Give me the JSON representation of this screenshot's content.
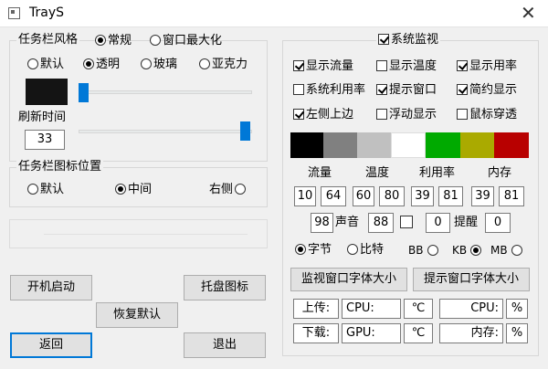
{
  "window": {
    "title": "TrayS",
    "close_glyph": "✕"
  },
  "taskbar_style": {
    "title": "任务栏风格",
    "mode_options": [
      "常规",
      "窗口最大化"
    ],
    "mode_selected": "常规",
    "effect_options": [
      "默认",
      "透明",
      "玻璃",
      "亚克力"
    ],
    "effect_selected": "透明",
    "color_swatch": "#141414",
    "alpha_level": 0.0,
    "refresh_label": "刷新时间",
    "refresh_value": "33",
    "refresh_level": 1.0
  },
  "icon_position": {
    "title": "任务栏图标位置",
    "options": [
      "默认",
      "中间",
      "右侧"
    ],
    "selected": "中间"
  },
  "left_buttons": {
    "autostart": "开机启动",
    "tray_icon": "托盘图标",
    "restore_default": "恢复默认",
    "back": "返回",
    "exit": "退出"
  },
  "monitor": {
    "title": "系统监视",
    "enabled": true,
    "checkboxes": [
      {
        "label": "显示流量",
        "checked": true
      },
      {
        "label": "显示温度",
        "checked": false
      },
      {
        "label": "显示用率",
        "checked": true
      },
      {
        "label": "系统利用率",
        "checked": false
      },
      {
        "label": "提示窗口",
        "checked": true
      },
      {
        "label": "简约显示",
        "checked": true
      },
      {
        "label": "左侧上边",
        "checked": true
      },
      {
        "label": "浮动显示",
        "checked": false
      },
      {
        "label": "鼠标穿透",
        "checked": false
      }
    ],
    "color_swatches": [
      "#000000",
      "#808080",
      "#c0c0c0",
      "#ffffff",
      "#00aa00",
      "#aaaa00",
      "#b80000"
    ],
    "headers": [
      "流量",
      "温度",
      "利用率",
      "内存"
    ],
    "threshold_values": [
      "10",
      "64",
      "60",
      "80",
      "39",
      "81",
      "39",
      "81"
    ],
    "sound_value": "98",
    "sound_label": "声音",
    "sound_threshold": "88",
    "remind_check": false,
    "remind_value": "0",
    "remind_label": "提醒",
    "remind_threshold": "0",
    "units": [
      {
        "label": "字节",
        "selected": true
      },
      {
        "label": "比特",
        "selected": false
      }
    ],
    "size_units": [
      {
        "label": "BB",
        "selected": false
      },
      {
        "label": "KB",
        "selected": true
      },
      {
        "label": "MB",
        "selected": false
      }
    ],
    "font_buttons": [
      "监视窗口字体大小",
      "提示窗口字体大小"
    ],
    "labels": {
      "upload": "上传:",
      "download": "下载:",
      "cpu": "CPU:",
      "gpu": "GPU:",
      "celsius": "℃",
      "cpu_right": "CPU:",
      "mem_right": "内存:",
      "percent": "%"
    }
  }
}
